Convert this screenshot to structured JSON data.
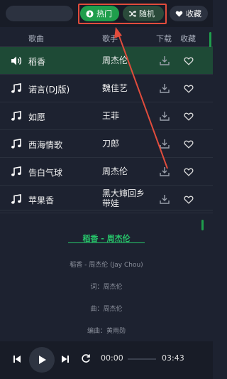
{
  "nav": {
    "hot_label": "热门",
    "random_label": "随机",
    "favorites_label": "收藏"
  },
  "table_header": {
    "song": "歌曲",
    "artist": "歌手",
    "download": "下载",
    "favorite": "收藏"
  },
  "songs": [
    {
      "title": "稻香",
      "artist": "周杰伦"
    },
    {
      "title": "诺言(DJ版)",
      "artist": "魏佳艺"
    },
    {
      "title": "如愿",
      "artist": "王菲"
    },
    {
      "title": "西海情歌",
      "artist": "刀郎"
    },
    {
      "title": "告白气球",
      "artist": "周杰伦"
    },
    {
      "title": "苹果香",
      "artist_line1": "黑大婶回乡",
      "artist_line2": "带娃"
    }
  ],
  "now_playing_index": 0,
  "lyrics": {
    "title": "稻香 - 周杰伦",
    "lines": [
      "稻香 - 周杰伦 (Jay Chou)",
      "词：周杰伦",
      "曲：周杰伦",
      "编曲：黄雨勋"
    ]
  },
  "player": {
    "current_time": "00:00",
    "total_time": "03:43",
    "progress": 0
  },
  "colors": {
    "accent": "#1f9e4c",
    "annotation": "#e14c3c"
  }
}
